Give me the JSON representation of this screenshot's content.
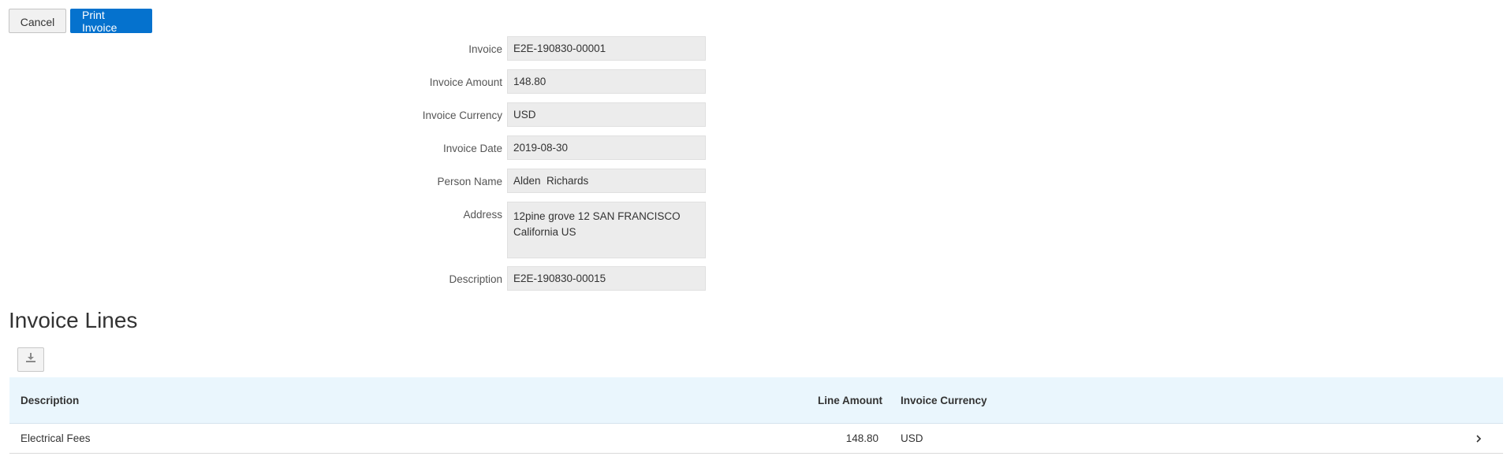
{
  "toolbar": {
    "cancel_label": "Cancel",
    "print_label": "Print Invoice"
  },
  "form": {
    "invoice": {
      "label": "Invoice",
      "value": "E2E-190830-00001"
    },
    "invoice_amount": {
      "label": "Invoice Amount",
      "value": "148.80"
    },
    "invoice_currency": {
      "label": "Invoice Currency",
      "value": "USD"
    },
    "invoice_date": {
      "label": "Invoice Date",
      "value": "2019-08-30"
    },
    "person_name": {
      "label": "Person Name",
      "value": "Alden  Richards"
    },
    "address": {
      "label": "Address",
      "value": "12pine grove 12   SAN FRANCISCO\nCalifornia US"
    },
    "description": {
      "label": "Description",
      "value": "E2E-190830-00015"
    }
  },
  "invoice_lines": {
    "title": "Invoice Lines",
    "export_icon": "download-icon",
    "columns": {
      "description": "Description",
      "line_amount": "Line Amount",
      "invoice_currency": "Invoice Currency"
    },
    "rows": [
      {
        "description": "Electrical Fees",
        "line_amount": "148.80",
        "invoice_currency": "USD",
        "action_icon": "chevron-right-icon"
      }
    ]
  },
  "colors": {
    "primary": "#0572ce",
    "field_bg": "#ececec",
    "table_header_bg": "#eaf6fd"
  }
}
